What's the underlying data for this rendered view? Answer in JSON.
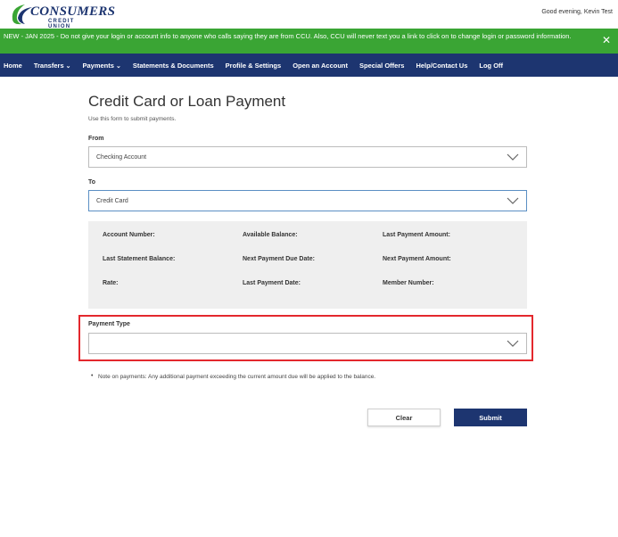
{
  "header": {
    "logo_main": "CONSUMERS",
    "logo_sub": "CREDIT UNION",
    "greeting": "Good evening, Kevin Test"
  },
  "alert": {
    "text": "NEW - JAN 2025 - Do not give your login or account info to anyone who calls saying they are from CCU. Also, CCU will never text you a link to click on to change login or password information.",
    "close_icon": "close-icon"
  },
  "nav": {
    "items": [
      {
        "label": "Home",
        "dropdown": false
      },
      {
        "label": "Transfers",
        "dropdown": true
      },
      {
        "label": "Payments",
        "dropdown": true
      },
      {
        "label": "Statements & Documents",
        "dropdown": false
      },
      {
        "label": "Profile & Settings",
        "dropdown": false
      },
      {
        "label": "Open an Account",
        "dropdown": false
      },
      {
        "label": "Special Offers",
        "dropdown": false
      },
      {
        "label": "Help/Contact Us",
        "dropdown": false
      },
      {
        "label": "Log Off",
        "dropdown": false
      }
    ]
  },
  "form": {
    "title": "Credit Card or Loan Payment",
    "subtitle": "Use this form to submit payments.",
    "from": {
      "label": "From",
      "value": "Checking Account"
    },
    "to": {
      "label": "To",
      "value": "Credit Card"
    },
    "info": {
      "account_number": "Account Number:",
      "available_balance": "Available Balance:",
      "last_payment_amount": "Last Payment Amount:",
      "last_statement_balance": "Last Statement Balance:",
      "next_payment_due_date": "Next Payment Due Date:",
      "next_payment_amount": "Next Payment Amount:",
      "rate": "Rate:",
      "last_payment_date": "Last Payment Date:",
      "member_number": "Member Number:"
    },
    "payment_type": {
      "label": "Payment Type",
      "value": ""
    },
    "note": "Note on payments: Any additional payment exceeding the current amount due will be applied to the balance.",
    "clear_label": "Clear",
    "submit_label": "Submit"
  },
  "colors": {
    "brand_navy": "#1d3570",
    "alert_green": "#3aa534",
    "highlight_red": "#e3282d"
  }
}
